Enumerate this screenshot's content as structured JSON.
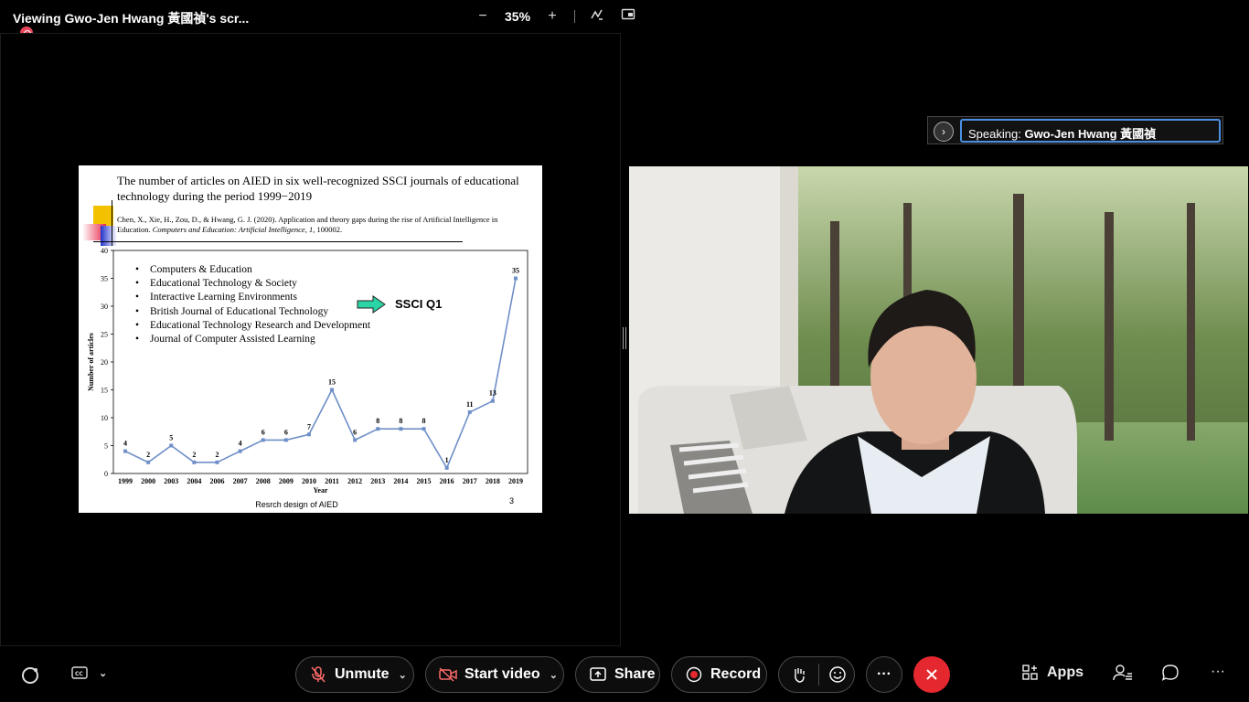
{
  "window": {
    "title": "Viewing Gwo-Jen Hwang 黃國禎's scr...",
    "zoom_level": "35%",
    "zoom_out": "−",
    "zoom_in": "+"
  },
  "slide": {
    "title": "The number of articles on AIED in six well-recognized SSCI journals of educational technology during the period 1999−2019",
    "citation_plain": "Chen, X., Xie, H., Zou, D., & Hwang, G. J. (2020). Application and theory gaps during the rise of Artificial Intelligence in Education. ",
    "citation_italic": "Computers and Education: Artificial Intelligence, 1,",
    "citation_end": " 100002.",
    "journals": [
      "Computers & Education",
      "Educational Technology & Society",
      "Interactive Learning Environments",
      "British Journal of Educational Technology",
      "Educational Technology Research and Development",
      "Journal of Computer Assisted Learning"
    ],
    "ssci_label": "SSCI Q1",
    "caption": "Resrch design of AIED",
    "page_number": "3"
  },
  "chart_data": {
    "type": "line",
    "x": [
      "1999",
      "2000",
      "2003",
      "2004",
      "2006",
      "2007",
      "2008",
      "2009",
      "2010",
      "2011",
      "2012",
      "2013",
      "2014",
      "2015",
      "2016",
      "2017",
      "2018",
      "2019"
    ],
    "values": [
      4,
      2,
      5,
      2,
      2,
      4,
      6,
      6,
      7,
      15,
      6,
      8,
      8,
      8,
      1,
      11,
      13,
      35
    ],
    "xlabel": "Year",
    "ylabel": "Number of articles",
    "ylim": [
      0,
      40
    ],
    "yticks": [
      0,
      5,
      10,
      15,
      20,
      25,
      30,
      35,
      40
    ],
    "line_color": "#6f8fc8",
    "grid": false
  },
  "speaking": {
    "prefix": "Speaking:",
    "name": "Gwo-Jen Hwang 黃國禎"
  },
  "toolbar": {
    "unmute": "Unmute",
    "start_video": "Start video",
    "share": "Share",
    "record": "Record",
    "more": "···",
    "apps": "Apps",
    "overflow": "···"
  },
  "colors": {
    "end_call": "#e5282f",
    "record_dot": "#e8475a",
    "speaking_border": "#4a90e2",
    "ssci_arrow": "#2bd4a4"
  }
}
